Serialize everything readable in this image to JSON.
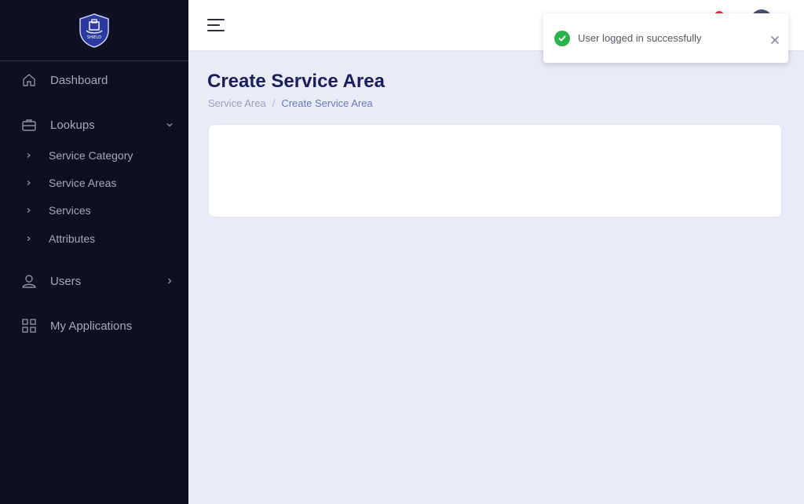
{
  "sidebar": {
    "logo_text": "SHIELD",
    "items": [
      {
        "label": "Dashboard",
        "icon": "home-icon"
      },
      {
        "label": "Lookups",
        "icon": "briefcase-icon",
        "expanded": true,
        "children": [
          {
            "label": "Service Category"
          },
          {
            "label": "Service Areas"
          },
          {
            "label": "Services"
          },
          {
            "label": "Attributes"
          }
        ]
      },
      {
        "label": "Users",
        "icon": "user-icon",
        "expanded": false
      },
      {
        "label": "My Applications",
        "icon": "grid-icon"
      }
    ]
  },
  "header": {
    "menu_icon": "hamburger-menu-icon"
  },
  "main": {
    "title": "Create Service Area",
    "breadcrumb": [
      {
        "label": "Service Area"
      },
      {
        "label": "Create Service Area"
      }
    ],
    "breadcrumb_separator": "/"
  },
  "toast": {
    "message": "User logged in successfully",
    "status": "success",
    "status_color": "#2bb24c"
  },
  "colors": {
    "sidebar_bg": "#0e0f22",
    "page_bg": "#e9ebf7",
    "title": "#1b1d5c",
    "notification": "#e0323a"
  }
}
